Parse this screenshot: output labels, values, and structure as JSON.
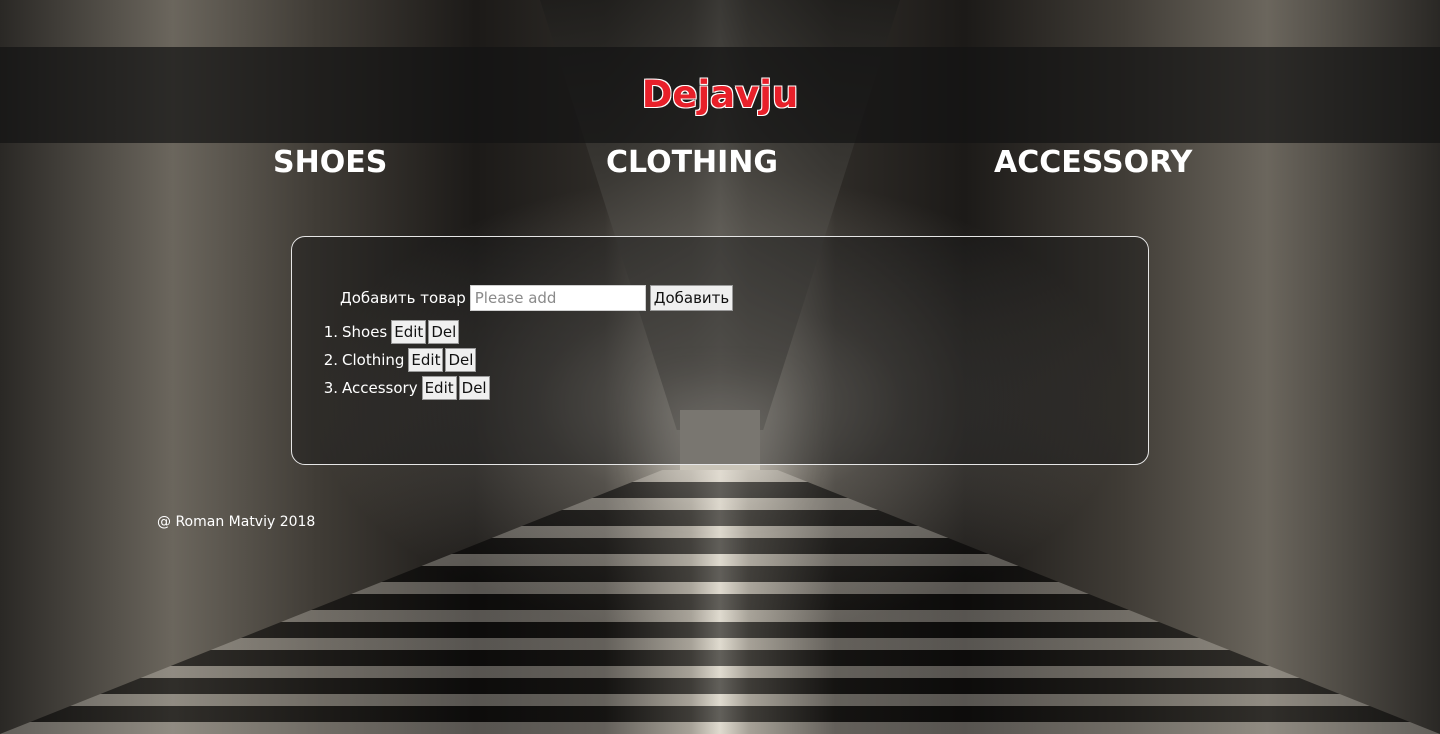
{
  "header": {
    "logo": "Dejavju"
  },
  "nav": [
    {
      "label": "SHOES"
    },
    {
      "label": "CLOTHING"
    },
    {
      "label": "ACCESSORY"
    }
  ],
  "form": {
    "label": "Добавить товар",
    "placeholder": "Please add",
    "value": "",
    "add_button": "Добавить"
  },
  "items": [
    {
      "num": "1.",
      "name": "Shoes",
      "edit": "Edit",
      "del": "Del"
    },
    {
      "num": "2.",
      "name": "Clothing",
      "edit": "Edit",
      "del": "Del"
    },
    {
      "num": "3.",
      "name": "Accessory",
      "edit": "Edit",
      "del": "Del"
    }
  ],
  "footer": {
    "text": "@ Roman Matviy 2018"
  },
  "colors": {
    "logo": "#e8202a",
    "header_bar": "#141414",
    "text": "#ffffff"
  }
}
